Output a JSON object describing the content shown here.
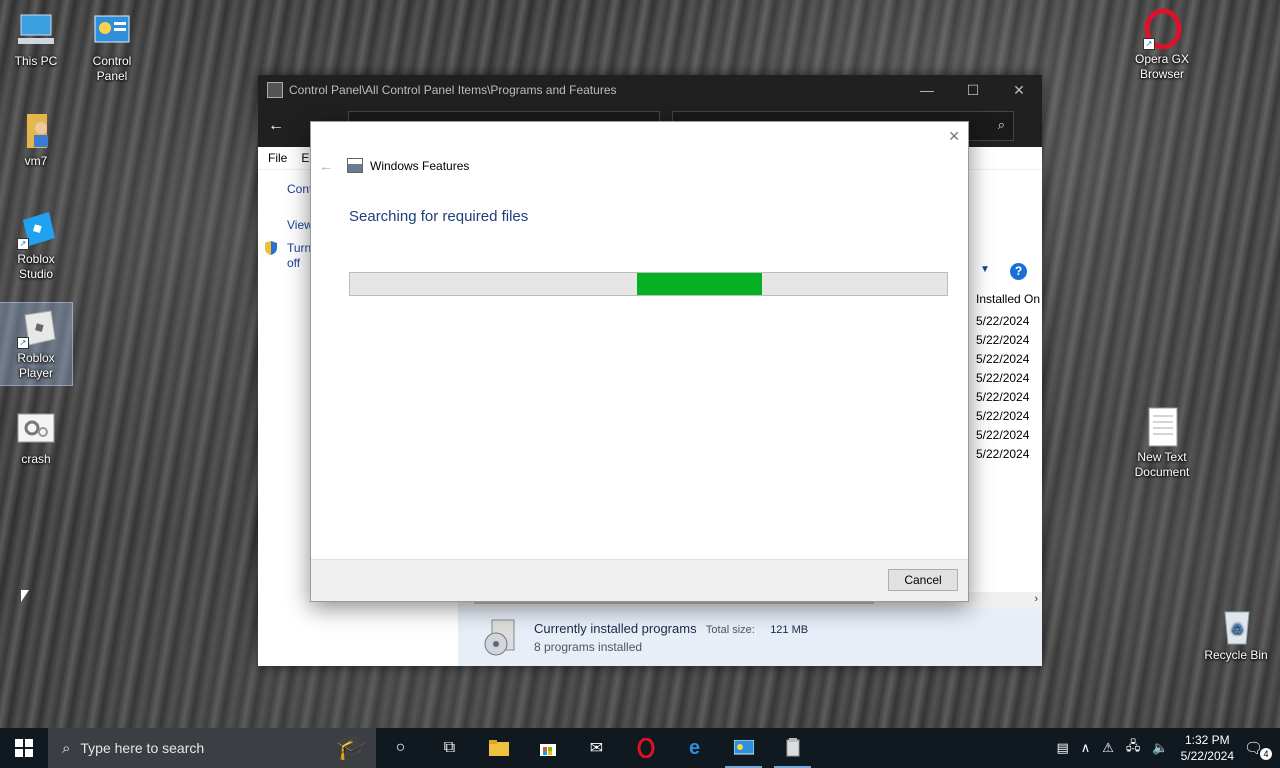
{
  "desktop": {
    "icons": [
      {
        "label": "This PC"
      },
      {
        "label": "Control Panel"
      },
      {
        "label": "vm7"
      },
      {
        "label": "Roblox Studio"
      },
      {
        "label": "Roblox Player"
      },
      {
        "label": "crash"
      },
      {
        "label": "Opera GX Browser"
      },
      {
        "label": "New Text Document"
      },
      {
        "label": "Recycle Bin"
      }
    ]
  },
  "control_panel": {
    "title": "Control Panel\\All Control Panel Items\\Programs and Features",
    "menu": {
      "file": "File",
      "edit": "Ed"
    },
    "left_links": {
      "control": "Contr",
      "view": "View",
      "turn_on": "Turn",
      "turn_off": "off"
    },
    "column_installed_on": "Installed On",
    "dates": [
      "5/22/2024",
      "5/22/2024",
      "5/22/2024",
      "5/22/2024",
      "5/22/2024",
      "5/22/2024",
      "5/22/2024",
      "5/22/2024"
    ],
    "status": {
      "title": "Currently installed programs",
      "total_size_label": "Total size:",
      "total_size_value": "121 MB",
      "count": "8 programs installed"
    }
  },
  "windows_features": {
    "title": "Windows Features",
    "heading": "Searching for required files",
    "progress": {
      "start_fraction": 0.48,
      "end_fraction": 0.69
    },
    "cancel_label": "Cancel"
  },
  "taskbar": {
    "search_placeholder": "Type here to search",
    "clock_time": "1:32 PM",
    "clock_date": "5/22/2024",
    "notification_count": "4"
  },
  "colors": {
    "progress_green": "#06b025",
    "link_blue": "#1c3f94",
    "heading_blue": "#1d3f7a"
  }
}
